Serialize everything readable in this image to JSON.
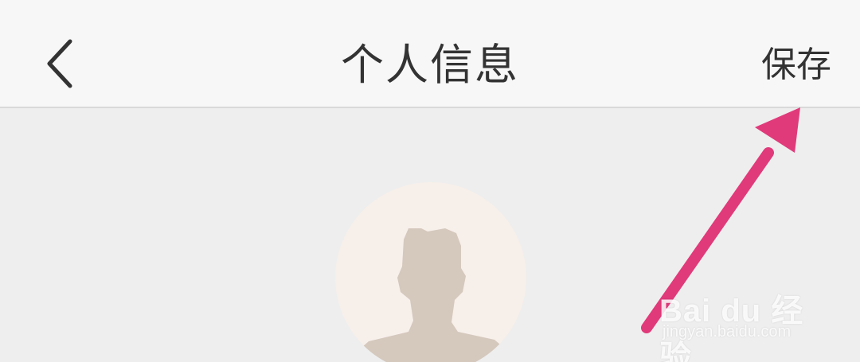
{
  "header": {
    "title": "个人信息",
    "save_label": "保存"
  },
  "colors": {
    "header_bg": "#f7f7f7",
    "content_bg": "#eeeeee",
    "text": "#333333",
    "arrow": "#e03a7a",
    "avatar_bg": "#f7efea",
    "avatar_figure": "#d5c8bd"
  },
  "icons": {
    "back": "chevron-left-icon",
    "avatar": "default-avatar-icon",
    "annotation": "pink-arrow-pointer"
  },
  "watermark": {
    "brand": "Bai du 经验",
    "url": "jingyan.baidu.com"
  }
}
